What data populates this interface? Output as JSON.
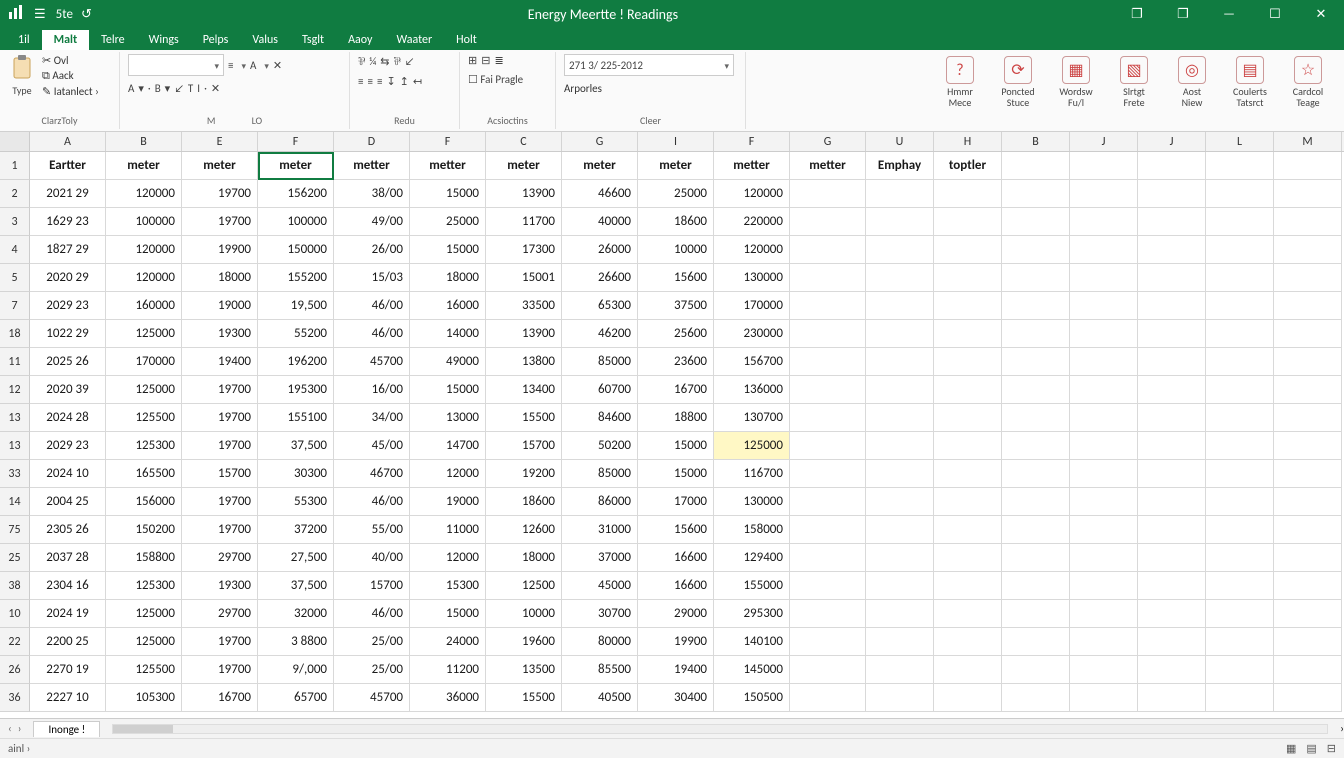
{
  "titlebar": {
    "qat": [
      "5te",
      "↺"
    ],
    "title": "Energy Meertte ! Readings",
    "win": {
      "restoreDown1": "❐",
      "restoreDown2": "❐",
      "min": "—",
      "max": "☐",
      "close": "✕"
    }
  },
  "tabs": {
    "file": "1il",
    "items": [
      "Malt",
      "Telre",
      "Wings",
      "Pelps",
      "Valus",
      "Tsglt",
      "Aaoy",
      "Waater",
      "Holt"
    ],
    "activeIndex": 0
  },
  "ribbon": {
    "clipboard": {
      "paste": "Type",
      "cut": "Ovl",
      "copy": "Aack",
      "fmt": "Iatanlect ›",
      "label": "ClarzToly"
    },
    "font": {
      "nameCombo": "",
      "alignBtn": "≡",
      "a": "A",
      "x": "✕",
      "label1": "M",
      "row2": [
        "A",
        "▾",
        "·",
        "B",
        "▾",
        "↙",
        "T",
        "I",
        "·",
        "✕"
      ],
      "label2": "LO"
    },
    "align": {
      "row1": [
        "⅌",
        "¼",
        "⇆",
        "⅌",
        "↙"
      ],
      "row2": [
        "≡",
        "≡",
        "≡",
        "↧",
        "↥",
        "↤"
      ],
      "label": "Redu"
    },
    "number": {
      "row1": [
        "⊞",
        "⊟",
        "≣"
      ],
      "row2": "Fai Pragle",
      "label": "Acsioctins"
    },
    "styles": {
      "combo": "271 3/ 225-2012",
      "row2": "Arporles",
      "label": "Cleer"
    },
    "rightGroups": [
      {
        "icon": "?",
        "l1": "Hmmr",
        "l2": "Mece"
      },
      {
        "icon": "⟳",
        "l1": "Poncted",
        "l2": "Stuce"
      },
      {
        "icon": "▦",
        "l1": "Wordsw",
        "l2": "Fu/l"
      },
      {
        "icon": "▧",
        "l1": "Slrtgt",
        "l2": "Frete"
      },
      {
        "icon": "◎",
        "l1": "Aost",
        "l2": "Niew"
      },
      {
        "icon": "▤",
        "l1": "Coulerts",
        "l2": "Tatsrct"
      },
      {
        "icon": "☆",
        "l1": "Cardcol",
        "l2": "Teage"
      }
    ]
  },
  "columns": [
    "A",
    "B",
    "E",
    "F",
    "D",
    "F",
    "C",
    "G",
    "I",
    "F",
    "G",
    "U",
    "H",
    "B",
    "J",
    "J",
    "L",
    "M"
  ],
  "colWidthClass": [
    "w-a",
    "w-b",
    "w-c",
    "w-d",
    "w-e",
    "w-f",
    "w-g",
    "w-h",
    "w-i",
    "w-j",
    "w-k",
    "w-l",
    "w-m",
    "w-n",
    "w-o",
    "w-p",
    "w-q",
    "w-r"
  ],
  "splitColWidthClass": "w-split",
  "rows": [
    {
      "rh": "1",
      "cells": [
        "Eartter",
        "meter",
        "meter",
        "meter",
        "metter",
        "metter",
        "meter",
        "meter",
        "meter",
        "metter",
        "metter",
        "Emphay",
        "toptler",
        "",
        "",
        "",
        "",
        ""
      ],
      "header": true
    },
    {
      "rh": "2",
      "cells": [
        "2021   29",
        "120000",
        "19700",
        "156200",
        "38/00",
        "15000",
        "13900",
        "46600",
        "25000",
        "120000",
        "",
        "",
        "",
        "",
        "",
        "",
        "",
        ""
      ]
    },
    {
      "rh": "3",
      "cells": [
        "1629   23",
        "100000",
        "19700",
        "100000",
        "49/00",
        "25000",
        "11700",
        "40000",
        "18600",
        "220000",
        "",
        "",
        "",
        "",
        "",
        "",
        "",
        ""
      ]
    },
    {
      "rh": "4",
      "cells": [
        "1827   29",
        "120000",
        "19900",
        "150000",
        "26/00",
        "15000",
        "17300",
        "26000",
        "10000",
        "120000",
        "",
        "",
        "",
        "",
        "",
        "",
        "",
        ""
      ]
    },
    {
      "rh": "5",
      "cells": [
        "2020   29",
        "120000",
        "18000",
        "155200",
        "15/03",
        "18000",
        "15001",
        "26600",
        "15600",
        "130000",
        "",
        "",
        "",
        "",
        "",
        "",
        "",
        ""
      ]
    },
    {
      "rh": "7",
      "cells": [
        "2029   23",
        "160000",
        "19000",
        "19,500",
        "46/00",
        "16000",
        "33500",
        "65300",
        "37500",
        "170000",
        "",
        "",
        "",
        "",
        "",
        "",
        "",
        ""
      ]
    },
    {
      "rh": "18",
      "cells": [
        "1022   29",
        "125000",
        "19300",
        "55200",
        "46/00",
        "14000",
        "13900",
        "46200",
        "25600",
        "230000",
        "",
        "",
        "",
        "",
        "",
        "",
        "",
        ""
      ]
    },
    {
      "rh": "11",
      "cells": [
        "2025   26",
        "170000",
        "19400",
        "196200",
        "45700",
        "49000",
        "13800",
        "85000",
        "23600",
        "156700",
        "",
        "",
        "",
        "",
        "",
        "",
        "",
        ""
      ]
    },
    {
      "rh": "12",
      "cells": [
        "2020   39",
        "125000",
        "19700",
        "195300",
        "16/00",
        "15000",
        "13400",
        "60700",
        "16700",
        "136000",
        "",
        "",
        "",
        "",
        "",
        "",
        "",
        ""
      ]
    },
    {
      "rh": "13",
      "cells": [
        "2024   28",
        "125500",
        "19700",
        "155100",
        "34/00",
        "13000",
        "15500",
        "84600",
        "18800",
        "130700",
        "",
        "",
        "",
        "",
        "",
        "",
        "",
        ""
      ]
    },
    {
      "rh": "13",
      "cells": [
        "2029   23",
        "125300",
        "19700",
        "37,500",
        "45/00",
        "14700",
        "15700",
        "50200",
        "15000",
        "125000",
        "",
        "",
        "",
        "",
        "",
        "",
        "",
        ""
      ],
      "hl": 9
    },
    {
      "rh": "33",
      "cells": [
        "2024   10",
        "165500",
        "15700",
        "30300",
        "46700",
        "12000",
        "19200",
        "85000",
        "15000",
        "116700",
        "",
        "",
        "",
        "",
        "",
        "",
        "",
        ""
      ]
    },
    {
      "rh": "14",
      "cells": [
        "2004   25",
        "156000",
        "19700",
        "55300",
        "46/00",
        "19000",
        "18600",
        "86000",
        "17000",
        "130000",
        "",
        "",
        "",
        "",
        "",
        "",
        "",
        ""
      ]
    },
    {
      "rh": "75",
      "cells": [
        "2305   26",
        "150200",
        "19700",
        "37200",
        "55/00",
        "11000",
        "12600",
        "31000",
        "15600",
        "158000",
        "",
        "",
        "",
        "",
        "",
        "",
        "",
        ""
      ]
    },
    {
      "rh": "25",
      "cells": [
        "2037   28",
        "158800",
        "29700",
        "27,500",
        "40/00",
        "12000",
        "18000",
        "37000",
        "16600",
        "129400",
        "",
        "",
        "",
        "",
        "",
        "",
        "",
        ""
      ]
    },
    {
      "rh": "38",
      "cells": [
        "2304   16",
        "125300",
        "19300",
        "37,500",
        "15700",
        "15300",
        "12500",
        "45000",
        "16600",
        "155000",
        "",
        "",
        "",
        "",
        "",
        "",
        "",
        ""
      ]
    },
    {
      "rh": "10",
      "cells": [
        "2024   19",
        "125000",
        "29700",
        "32000",
        "46/00",
        "15000",
        "10000",
        "30700",
        "29000",
        "295300",
        "",
        "",
        "",
        "",
        "",
        "",
        "",
        ""
      ]
    },
    {
      "rh": "22",
      "cells": [
        "2200   25",
        "125000",
        "19700",
        "3 8800",
        "25/00",
        "24000",
        "19600",
        "80000",
        "19900",
        "140100",
        "",
        "",
        "",
        "",
        "",
        "",
        "",
        ""
      ]
    },
    {
      "rh": "26",
      "cells": [
        "2270   19",
        "125500",
        "19700",
        "9/,000",
        "25/00",
        "11200",
        "13500",
        "85500",
        "19400",
        "145000",
        "",
        "",
        "",
        "",
        "",
        "",
        "",
        ""
      ]
    },
    {
      "rh": "36",
      "cells": [
        "2227   10",
        "105300",
        "16700",
        "65700",
        "45700",
        "36000",
        "15500",
        "40500",
        "30400",
        "150500",
        "",
        "",
        "",
        "",
        "",
        "",
        "",
        ""
      ]
    }
  ],
  "selectedCell": {
    "row": 0,
    "col": 3
  },
  "sheetTabs": {
    "nav": [
      "‹",
      "›"
    ],
    "active": "Inonge !"
  },
  "statusbar": {
    "left": "ainl  ›",
    "views": [
      "▦",
      "▤",
      "⊟"
    ]
  }
}
